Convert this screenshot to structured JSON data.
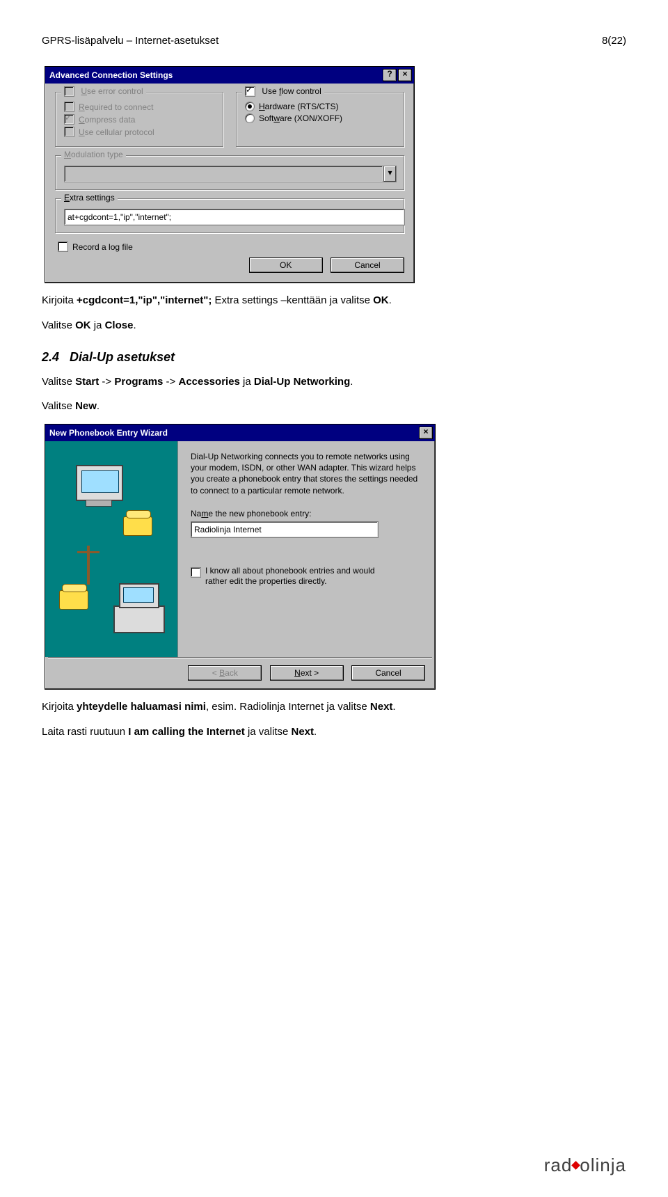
{
  "header": {
    "left": "GPRS-lisäpalvelu – Internet-asetukset",
    "right": "8(22)"
  },
  "dlg1": {
    "title": "Advanced Connection Settings",
    "help_btn": "?",
    "close_btn": "×",
    "left_group": {
      "legend_pre": "U",
      "legend_post": "se error control",
      "required_pre": "R",
      "required_post": "equired to connect",
      "compress_pre": "C",
      "compress_post": "ompress data",
      "cellular_pre": "U",
      "cellular_post": "se cellular protocol"
    },
    "right_group": {
      "flow_pre": "Use ",
      "flow_u": "f",
      "flow_post": "low control",
      "hw_pre": "H",
      "hw_post": "ardware (RTS/CTS)",
      "sw_pre": "Soft",
      "sw_u": "w",
      "sw_post": "are (XON/XOFF)"
    },
    "modulation_legend_pre": "M",
    "modulation_legend_post": "odulation type",
    "extra_legend_pre": "E",
    "extra_legend_post": "xtra settings",
    "extra_value": "at+cgdcont=1,\"ip\",\"internet\";",
    "recordlog_pre": "Record a lo",
    "recordlog_u": "g",
    "recordlog_post": " file",
    "ok": "OK",
    "cancel": "Cancel"
  },
  "para1_a": "Kirjoita ",
  "para1_b": "+cgdcont=1,\"ip\",\"internet\";",
  "para1_c": " Extra settings –kenttään ja valitse ",
  "para1_d": "OK",
  "para1_e": ".",
  "para2_a": "Valitse ",
  "para2_b": "OK",
  "para2_c": " ja ",
  "para2_d": "Close",
  "para2_e": ".",
  "sect": {
    "num": "2.4",
    "title": "Dial-Up asetukset"
  },
  "para3_a": "Valitse ",
  "para3_b": "Start",
  "para3_c": " -> ",
  "para3_d": "Programs",
  "para3_e": " -> ",
  "para3_f": "Accessories",
  "para3_g": " ja ",
  "para3_h": "Dial-Up Networking",
  "para3_i": ".",
  "para4_a": "Valitse ",
  "para4_b": "New",
  "para4_c": ".",
  "dlg2": {
    "title": "New Phonebook Entry Wizard",
    "close_btn": "×",
    "intro": "Dial-Up Networking connects you to remote networks using your modem, ISDN, or other WAN adapter. This wizard helps you create a phonebook entry that stores the settings needed to connect to a particular remote network.",
    "label_pre": "Na",
    "label_u": "m",
    "label_post": "e the new phonebook entry:",
    "value": "Radiolinja Internet",
    "chk_text": "I know all about phonebook entries and would rather edit the properties directly.",
    "back_pre": "< ",
    "back_u": "B",
    "back_post": "ack",
    "next_pre": "",
    "next_u": "N",
    "next_post": "ext >",
    "cancel": "Cancel"
  },
  "para5_a": "Kirjoita ",
  "para5_b": "yhteydelle haluamasi nimi",
  "para5_c": ", esim. Radiolinja Internet ja valitse ",
  "para5_d": "Next",
  "para5_e": ".",
  "para6_a": "Laita rasti ruutuun ",
  "para6_b": "I am calling the Internet",
  "para6_c": " ja valitse ",
  "para6_d": "Next",
  "para6_e": ".",
  "footer_brand": "radiolinja"
}
